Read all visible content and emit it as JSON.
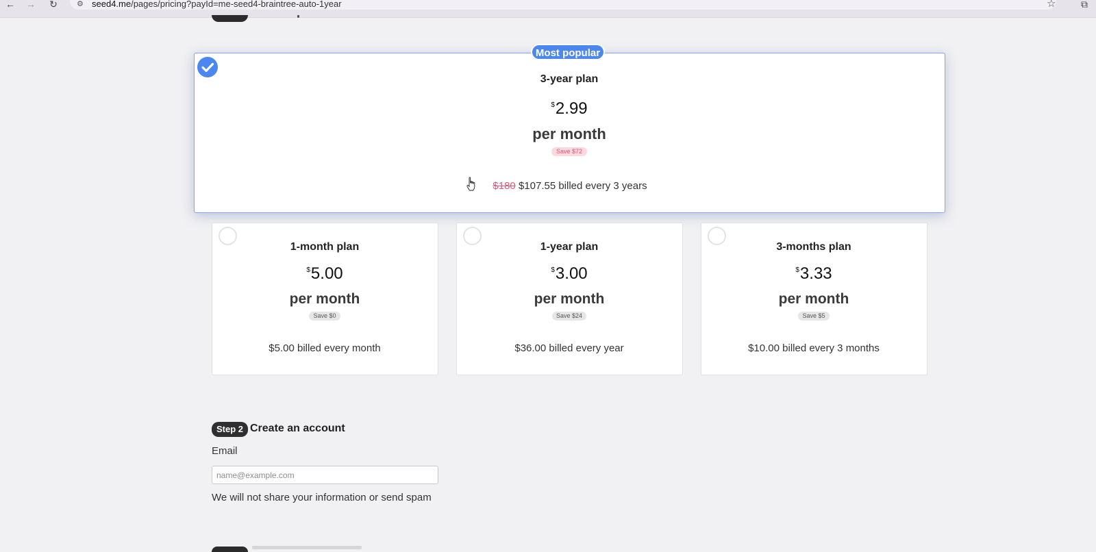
{
  "browser": {
    "url_host": "seed4.me",
    "url_path": "/pages/pricing?payId=me-seed4-braintree-auto-1year",
    "icons": [
      "back-arrow-icon",
      "forward-arrow-icon",
      "reload-icon",
      "site-settings-icon",
      "star-icon",
      "extensions-icon"
    ]
  },
  "featured": {
    "badge": "Most popular",
    "title": "3-year plan",
    "currency": "$",
    "price": "2.99",
    "per": "per month",
    "save": "Save $72",
    "old_price": "$180",
    "billed": "$107.55 billed every 3 years",
    "selected": true
  },
  "plans": [
    {
      "title": "1-month plan",
      "currency": "$",
      "price": "5.00",
      "per": "per month",
      "save": "Save $0",
      "billed": "$5.00 billed every month"
    },
    {
      "title": "1-year plan",
      "currency": "$",
      "price": "3.00",
      "per": "per month",
      "save": "Save $24",
      "billed": "$36.00 billed every year"
    },
    {
      "title": "3-months plan",
      "currency": "$",
      "price": "3.33",
      "per": "per month",
      "save": "Save $5",
      "billed": "$10.00 billed every 3 months"
    }
  ],
  "step2": {
    "badge": "Step 2",
    "title": "Create an account",
    "email_label": "Email",
    "email_placeholder": "name@example.com",
    "email_value": "",
    "privacy_note": "We will not share your information or send spam"
  },
  "colors": {
    "accent": "#4c86ef",
    "save_pink_bg": "#fbd9df",
    "save_pink_text": "#e0557a"
  }
}
